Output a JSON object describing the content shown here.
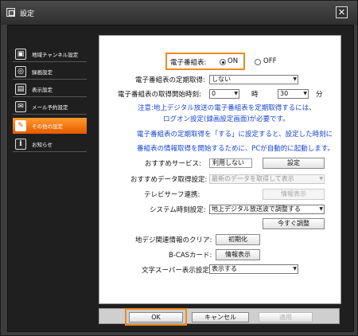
{
  "window": {
    "title": "設定",
    "close_label": "✕"
  },
  "sidebar": {
    "items": [
      {
        "label": "地域チャンネル設定",
        "icon": "tv-antenna-icon",
        "glyph": "▣"
      },
      {
        "label": "録画設定",
        "icon": "record-icon",
        "glyph": "◎"
      },
      {
        "label": "表示設定",
        "icon": "display-settings-icon",
        "glyph": "▤"
      },
      {
        "label": "メール予約設定",
        "icon": "mail-icon",
        "glyph": "✉"
      },
      {
        "label": "その他の設定",
        "icon": "tools-icon",
        "glyph": "✎",
        "active": true
      },
      {
        "label": "お知らせ",
        "icon": "info-icon",
        "glyph": "i"
      }
    ]
  },
  "epg": {
    "label": "電子番組表:",
    "on_label": "ON",
    "off_label": "OFF",
    "selected": "ON",
    "periodic_label": "電子番組表の定期取得:",
    "periodic_value": "しない",
    "start_label": "電子番組表の取得開始時刻:",
    "hour_value": "0",
    "hour_unit": "時",
    "minute_value": "30",
    "minute_unit": "分"
  },
  "notes": {
    "line1": "注意:地上デジタル放送の電子番組表を定期取得するには、",
    "line2": "ログオン設定(録画設定画面)が必要です。",
    "line3": "電子番組表の定期取得を「する」に設定すると、設定した時刻に",
    "line4": "番組表の情報取得を開始するために、PCが自動的に起動します。"
  },
  "recommend": {
    "service_label": "おすすめサービス:",
    "service_value": "利用しない",
    "service_button": "設定",
    "data_label": "おすすめデータ取得設定:",
    "data_value": "最新のデータを取得して表示"
  },
  "tvsurfer": {
    "label": "テレビサーフ連携:",
    "button": "情報表示"
  },
  "clock": {
    "label": "システム時刻設定:",
    "value": "地上デジタル放送波で調整する",
    "adjust_button": "今すぐ調整"
  },
  "digital_clear": {
    "label": "地デジ関連情報のクリア:",
    "button": "初期化"
  },
  "bcas": {
    "label": "B-CASカード:",
    "button": "情報表示"
  },
  "superimpose": {
    "label": "文字スーパー表示設定:",
    "value": "表示する"
  },
  "footer": {
    "ok": "OK",
    "cancel": "キャンセル",
    "apply": "適用"
  },
  "colors": {
    "accent": "#f08a1c",
    "active_item": "#e85d00",
    "note_text": "#1846d6",
    "window_bg": "#3d3d3d"
  }
}
